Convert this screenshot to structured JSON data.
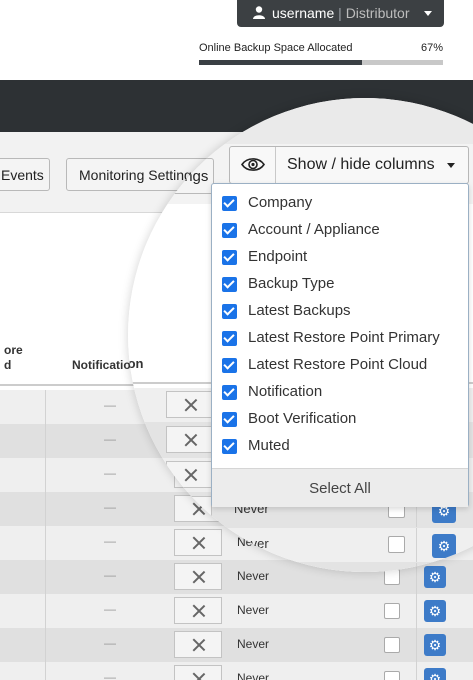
{
  "user": {
    "name": "username",
    "separator": "|",
    "role": "Distributor"
  },
  "backup": {
    "label": "Online Backup Space Allocated",
    "percent_text": "67%",
    "percent": 0.67
  },
  "toolbar": {
    "events_label": "Events",
    "monitoring_label": "Monitoring Settings"
  },
  "table": {
    "header_restore_line1": "ore",
    "header_restore_line2": "d",
    "header_notification": "Notification",
    "dash": "—",
    "never": "Never",
    "gear": "⚙"
  },
  "columns_button": {
    "label": "Show / hide columns"
  },
  "column_menu": {
    "items": [
      {
        "label": "Company",
        "checked": true
      },
      {
        "label": "Account / Appliance",
        "checked": true
      },
      {
        "label": "Endpoint",
        "checked": true
      },
      {
        "label": "Backup Type",
        "checked": true
      },
      {
        "label": "Latest Backups",
        "checked": true
      },
      {
        "label": "Latest Restore Point Primary",
        "checked": true
      },
      {
        "label": "Latest Restore Point Cloud",
        "checked": true
      },
      {
        "label": "Notification",
        "checked": true
      },
      {
        "label": "Boot Verification",
        "checked": true
      },
      {
        "label": "Muted",
        "checked": true
      }
    ],
    "select_all_label": "Select All"
  },
  "colors": {
    "navbar": "#2d3134",
    "accent": "#1a73e8",
    "gear_button": "#3d7bc8"
  }
}
